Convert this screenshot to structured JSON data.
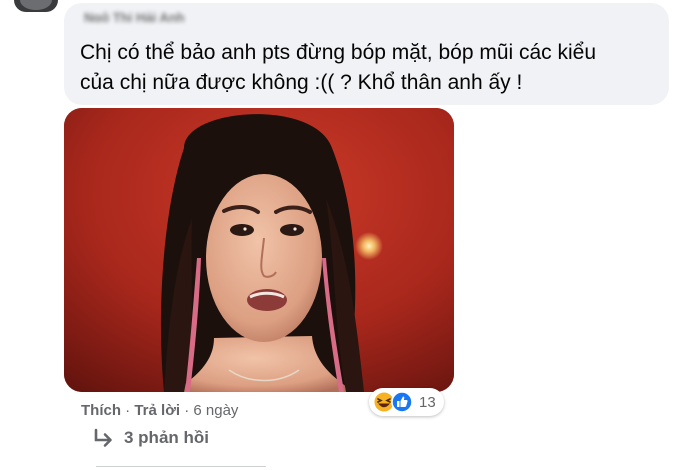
{
  "comment": {
    "author": "Ngô Thị Hải Anh",
    "text": "Chị có thể bảo anh pts đừng bóp mặt, bóp mũi các kiểu\ncủa chị nữa được không :(( ? Khổ thân anh ấy !"
  },
  "actions": {
    "like": "Thích",
    "reply": "Trả lời",
    "separator": "·",
    "time": "6 ngày"
  },
  "reactions": {
    "icons": [
      "haha-icon",
      "like-icon"
    ],
    "count": "13"
  },
  "replies": {
    "label": "3 phản hồi"
  },
  "colors": {
    "bubble": "#f0f2f5",
    "text": "#050505",
    "secondary": "#65676b",
    "like_blue": "#1877f2",
    "haha_yellow": "#f7b125"
  }
}
